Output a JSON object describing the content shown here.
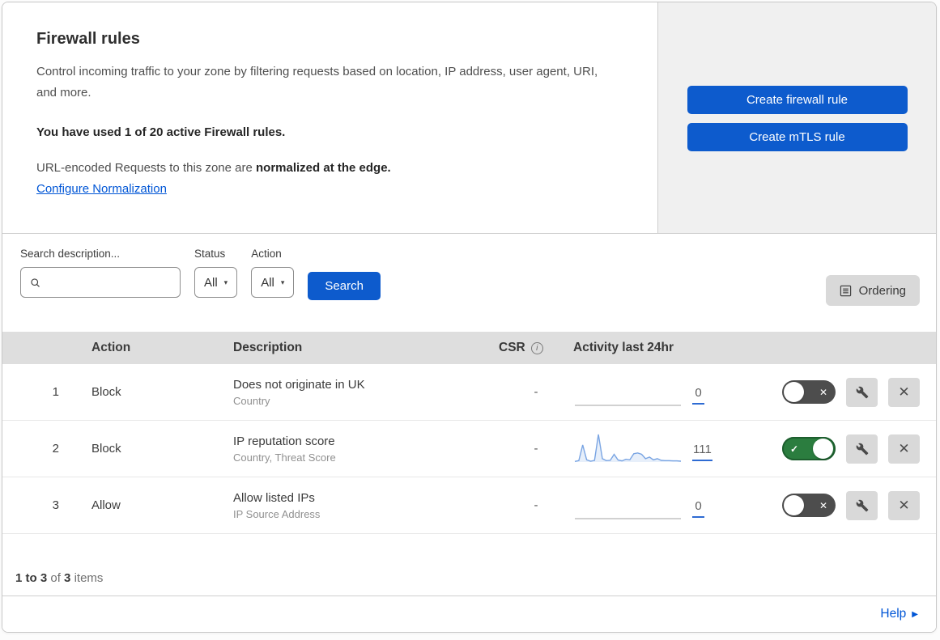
{
  "intro": {
    "title": "Firewall rules",
    "description": "Control incoming traffic to your zone by filtering requests based on location, IP address, user agent, URI, and more.",
    "usage": "You have used 1 of 20 active Firewall rules.",
    "normalization_prefix": "URL-encoded Requests to this zone are ",
    "normalization_bold": "normalized at the edge.",
    "normalization_link": "Configure Normalization"
  },
  "actions_panel": {
    "create_firewall_rule": "Create firewall rule",
    "create_mtls_rule": "Create mTLS rule"
  },
  "filters": {
    "search_label": "Search description...",
    "status_label": "Status",
    "status_value": "All",
    "action_label": "Action",
    "action_value": "All",
    "search_button": "Search",
    "ordering_button": "Ordering"
  },
  "table": {
    "headers": {
      "action": "Action",
      "description": "Description",
      "csr": "CSR",
      "activity": "Activity last 24hr"
    },
    "rows": [
      {
        "priority": "1",
        "action": "Block",
        "description": "Does not originate in UK",
        "criteria": "Country",
        "csr": "-",
        "activity_count": "0",
        "sparkline": null,
        "enabled": false
      },
      {
        "priority": "2",
        "action": "Block",
        "description": "IP reputation score",
        "criteria": "Country, Threat Score",
        "csr": "-",
        "activity_count": "111",
        "sparkline": [
          0.02,
          0.05,
          0.62,
          0.08,
          0.03,
          0.06,
          1.0,
          0.12,
          0.05,
          0.06,
          0.28,
          0.07,
          0.04,
          0.1,
          0.08,
          0.3,
          0.33,
          0.28,
          0.12,
          0.18,
          0.08,
          0.12,
          0.06,
          0.05,
          0.05,
          0.04,
          0.04,
          0.03
        ],
        "enabled": true
      },
      {
        "priority": "3",
        "action": "Allow",
        "description": "Allow listed IPs",
        "criteria": "IP Source Address",
        "csr": "-",
        "activity_count": "0",
        "sparkline": null,
        "enabled": false
      }
    ]
  },
  "footer": {
    "range": "1 to 3",
    "of": "of",
    "total": "3",
    "items": "items"
  },
  "help": {
    "label": "Help"
  },
  "icons": {
    "caret": "▾",
    "check": "✓",
    "cross": "✕",
    "help_arrow": "▶",
    "info": "i"
  },
  "colors": {
    "primary_blue": "#0d5bcd",
    "link_blue": "#0056d6",
    "toggle_on_green": "#2b7d3f",
    "toggle_off_gray": "#4d4d4d",
    "sparkline_blue": "#7aa5e3",
    "table_header_gray": "#dedede",
    "side_panel_gray": "#f0f0f0"
  }
}
